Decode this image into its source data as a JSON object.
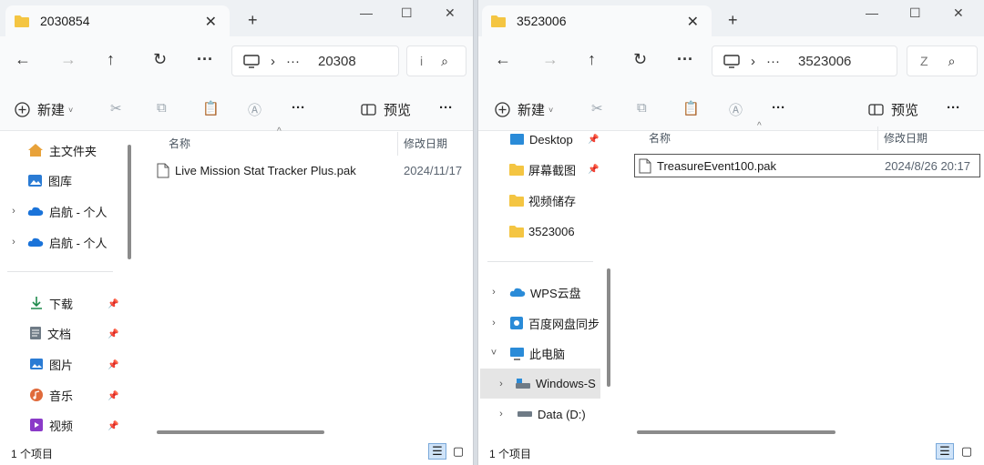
{
  "left_window": {
    "tab_title": "2030854",
    "address_crumb": "20308",
    "address_ellipsis": "···",
    "search_placeholder": "i",
    "toolbar": {
      "new_label": "新建",
      "preview_label": "预览"
    },
    "nav": [
      {
        "label": "主文件夹",
        "icon": "home-icon"
      },
      {
        "label": "图库",
        "icon": "gallery-icon"
      },
      {
        "label": "启航 - 个人",
        "icon": "cloud-icon"
      },
      {
        "label": "启航 - 个人",
        "icon": "cloud-icon"
      },
      {
        "label": "下载",
        "icon": "download-icon"
      },
      {
        "label": "文档",
        "icon": "document-icon"
      },
      {
        "label": "图片",
        "icon": "pictures-icon"
      },
      {
        "label": "音乐",
        "icon": "music-icon"
      },
      {
        "label": "视频",
        "icon": "video-icon"
      }
    ],
    "columns": {
      "name": "名称",
      "date": "修改日期"
    },
    "files": [
      {
        "name": "Live Mission Stat Tracker Plus.pak",
        "date": "2024/11/17"
      }
    ],
    "status": "1 个项目"
  },
  "right_window": {
    "tab_title": "3523006",
    "address_crumb": "3523006",
    "address_ellipsis": "···",
    "search_placeholder": "Z",
    "toolbar": {
      "new_label": "新建",
      "preview_label": "预览"
    },
    "nav": [
      {
        "label": "Desktop",
        "icon": "desktop-icon"
      },
      {
        "label": "屏幕截图",
        "icon": "folder-icon"
      },
      {
        "label": "视频储存",
        "icon": "folder-icon"
      },
      {
        "label": "3523006",
        "icon": "folder-icon"
      },
      {
        "label": "WPS云盘",
        "icon": "cloud-icon"
      },
      {
        "label": "百度网盘同步",
        "icon": "baidu-sync-icon"
      },
      {
        "label": "此电脑",
        "icon": "this-pc-icon"
      },
      {
        "label": "Windows-S",
        "icon": "drive-icon"
      },
      {
        "label": "Data (D:)",
        "icon": "drive-icon"
      }
    ],
    "columns": {
      "name": "名称",
      "date": "修改日期"
    },
    "files": [
      {
        "name": "TreasureEvent100.pak",
        "date": "2024/8/26 20:17"
      }
    ],
    "status": "1 个项目"
  },
  "colors": {
    "folder": "#f4c542",
    "accent": "#0067c0",
    "selected": "#e5e5e5",
    "chrome": "#eef1f4"
  }
}
